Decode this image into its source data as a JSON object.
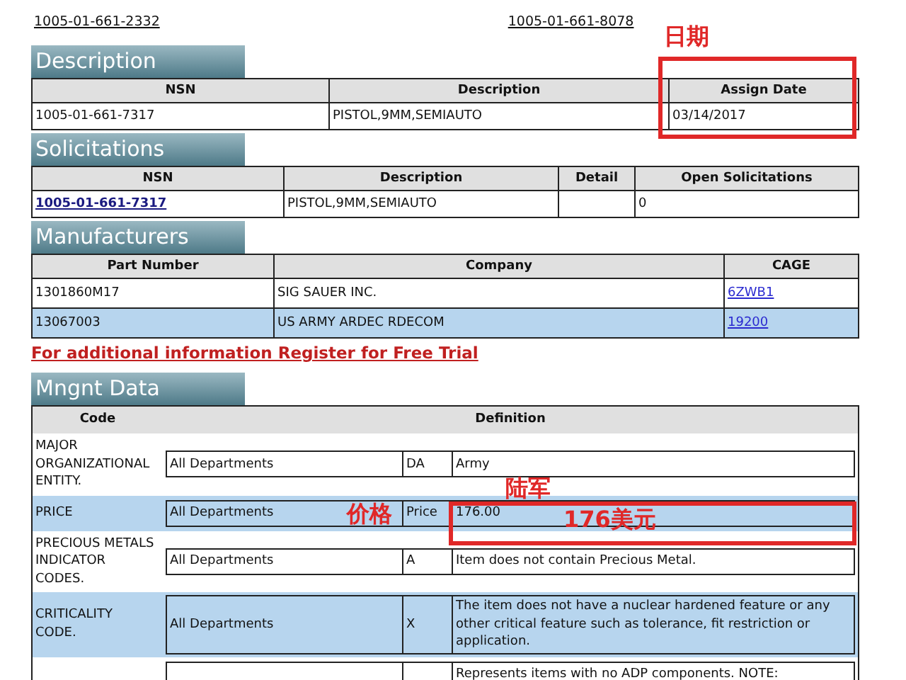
{
  "top_links": [
    "1005-01-661-2332",
    "1005-01-661-8078"
  ],
  "description": {
    "title": "Description",
    "columns": [
      "NSN",
      "Description",
      "Assign Date"
    ],
    "rows": [
      [
        "1005-01-661-7317",
        "PISTOL,9MM,SEMIAUTO",
        "03/14/2017"
      ]
    ]
  },
  "solicitations": {
    "title": "Solicitations",
    "columns": [
      "NSN",
      "Description",
      "Detail",
      "Open Solicitations"
    ],
    "rows": [
      {
        "nsn": "1005-01-661-7317",
        "description": "PISTOL,9MM,SEMIAUTO",
        "detail": "",
        "open": "0"
      }
    ]
  },
  "manufacturers": {
    "title": "Manufacturers",
    "columns": [
      "Part Number",
      "Company",
      "CAGE"
    ],
    "rows": [
      {
        "part": "1301860M17",
        "company": "SIG SAUER INC.",
        "cage": "6ZWB1",
        "highlighted": false
      },
      {
        "part": "13067003",
        "company": "US ARMY ARDEC RDECOM",
        "cage": "19200",
        "highlighted": true
      }
    ]
  },
  "register_link": "For additional information Register for Free Trial",
  "mngnt": {
    "title": "Mngnt Data",
    "columns": [
      "Code",
      "Definition"
    ],
    "rows": [
      {
        "code": "MAJOR ORGANIZATIONAL ENTITY.",
        "scope": "All Departments",
        "value": "DA",
        "definition": "Army",
        "highlighted": false
      },
      {
        "code": "PRICE",
        "scope": "All Departments",
        "value": "Price",
        "definition": "176.00",
        "highlighted": true
      },
      {
        "code": "PRECIOUS METALS INDICATOR CODES.",
        "scope": "All Departments",
        "value": "A",
        "definition": "Item does not contain Precious Metal.",
        "highlighted": false
      },
      {
        "code": "CRITICALITY CODE.",
        "scope": "All Departments",
        "value": "X",
        "definition": "The item does not have a nuclear hardened feature or any other critical feature such as tolerance, fit restriction or application.",
        "highlighted": true
      },
      {
        "code": "",
        "scope": "",
        "value": "",
        "definition": "Represents items with no ADP components. NOTE:",
        "highlighted": false
      }
    ]
  },
  "annotations": [
    {
      "kind": "label",
      "text": "日期"
    },
    {
      "kind": "box"
    },
    {
      "kind": "label",
      "text": "陆军"
    },
    {
      "kind": "label",
      "text": "价格"
    },
    {
      "kind": "box"
    },
    {
      "kind": "label",
      "text": "176美元"
    }
  ]
}
